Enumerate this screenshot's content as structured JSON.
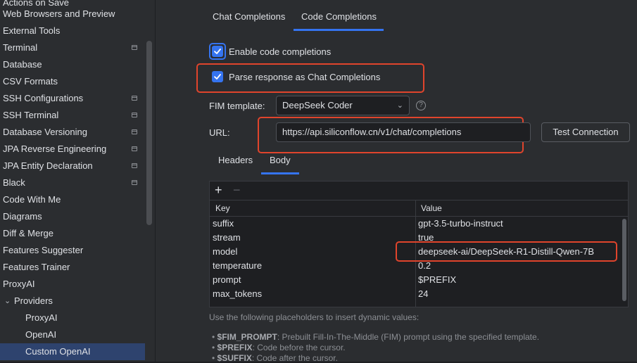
{
  "sidebar": {
    "items": [
      {
        "label": "Actions on Save",
        "icon": false
      },
      {
        "label": "Web Browsers and Preview",
        "icon": false
      },
      {
        "label": "External Tools",
        "icon": false
      },
      {
        "label": "Terminal",
        "icon": true
      },
      {
        "label": "Database",
        "icon": false
      },
      {
        "label": "CSV Formats",
        "icon": false
      },
      {
        "label": "SSH Configurations",
        "icon": true
      },
      {
        "label": "SSH Terminal",
        "icon": true
      },
      {
        "label": "Database Versioning",
        "icon": true
      },
      {
        "label": "JPA Reverse Engineering",
        "icon": true
      },
      {
        "label": "JPA Entity Declaration",
        "icon": true
      },
      {
        "label": "Black",
        "icon": true
      },
      {
        "label": "Code With Me",
        "icon": false
      },
      {
        "label": "Diagrams",
        "icon": false
      },
      {
        "label": "Diff & Merge",
        "icon": false
      },
      {
        "label": "Features Suggester",
        "icon": false
      },
      {
        "label": "Features Trainer",
        "icon": false
      },
      {
        "label": "ProxyAI",
        "icon": false
      },
      {
        "label": "Providers",
        "icon": false
      },
      {
        "label": "ProxyAI",
        "icon": false
      },
      {
        "label": "OpenAI",
        "icon": false
      },
      {
        "label": "Custom OpenAI",
        "icon": false
      }
    ]
  },
  "tabs": {
    "chat": "Chat Completions",
    "code": "Code Completions"
  },
  "options": {
    "enable_code_completions": "Enable code completions",
    "parse_response": "Parse response as Chat Completions"
  },
  "fim": {
    "label": "FIM template:",
    "value": "DeepSeek Coder"
  },
  "url": {
    "label": "URL:",
    "value": "https://api.siliconflow.cn/v1/chat/completions",
    "test_button": "Test Connection"
  },
  "subtabs": {
    "headers": "Headers",
    "body": "Body"
  },
  "table": {
    "add": "+",
    "remove": "−",
    "col_key": "Key",
    "col_value": "Value",
    "rows": [
      {
        "key": "suffix",
        "value": "gpt-3.5-turbo-instruct"
      },
      {
        "key": "stream",
        "value": "true"
      },
      {
        "key": "model",
        "value": "deepseek-ai/DeepSeek-R1-Distill-Qwen-7B"
      },
      {
        "key": "temperature",
        "value": "0.2"
      },
      {
        "key": "prompt",
        "value": "$PREFIX"
      },
      {
        "key": "max_tokens",
        "value": "24"
      }
    ]
  },
  "hints": {
    "intro": "Use the following placeholders to insert dynamic values:",
    "fim_prompt_key": "$FIM_PROMPT",
    "fim_prompt_desc": ": Prebuilt Fill-In-The-Middle (FIM) prompt using the specified template.",
    "prefix_key": "$PREFIX",
    "prefix_desc": ": Code before the cursor.",
    "suffix_key": "$SUFFIX",
    "suffix_desc": ": Code after the cursor."
  },
  "colors": {
    "accent": "#3574f0",
    "annotation": "#e0442c",
    "selection": "#2e436e"
  }
}
